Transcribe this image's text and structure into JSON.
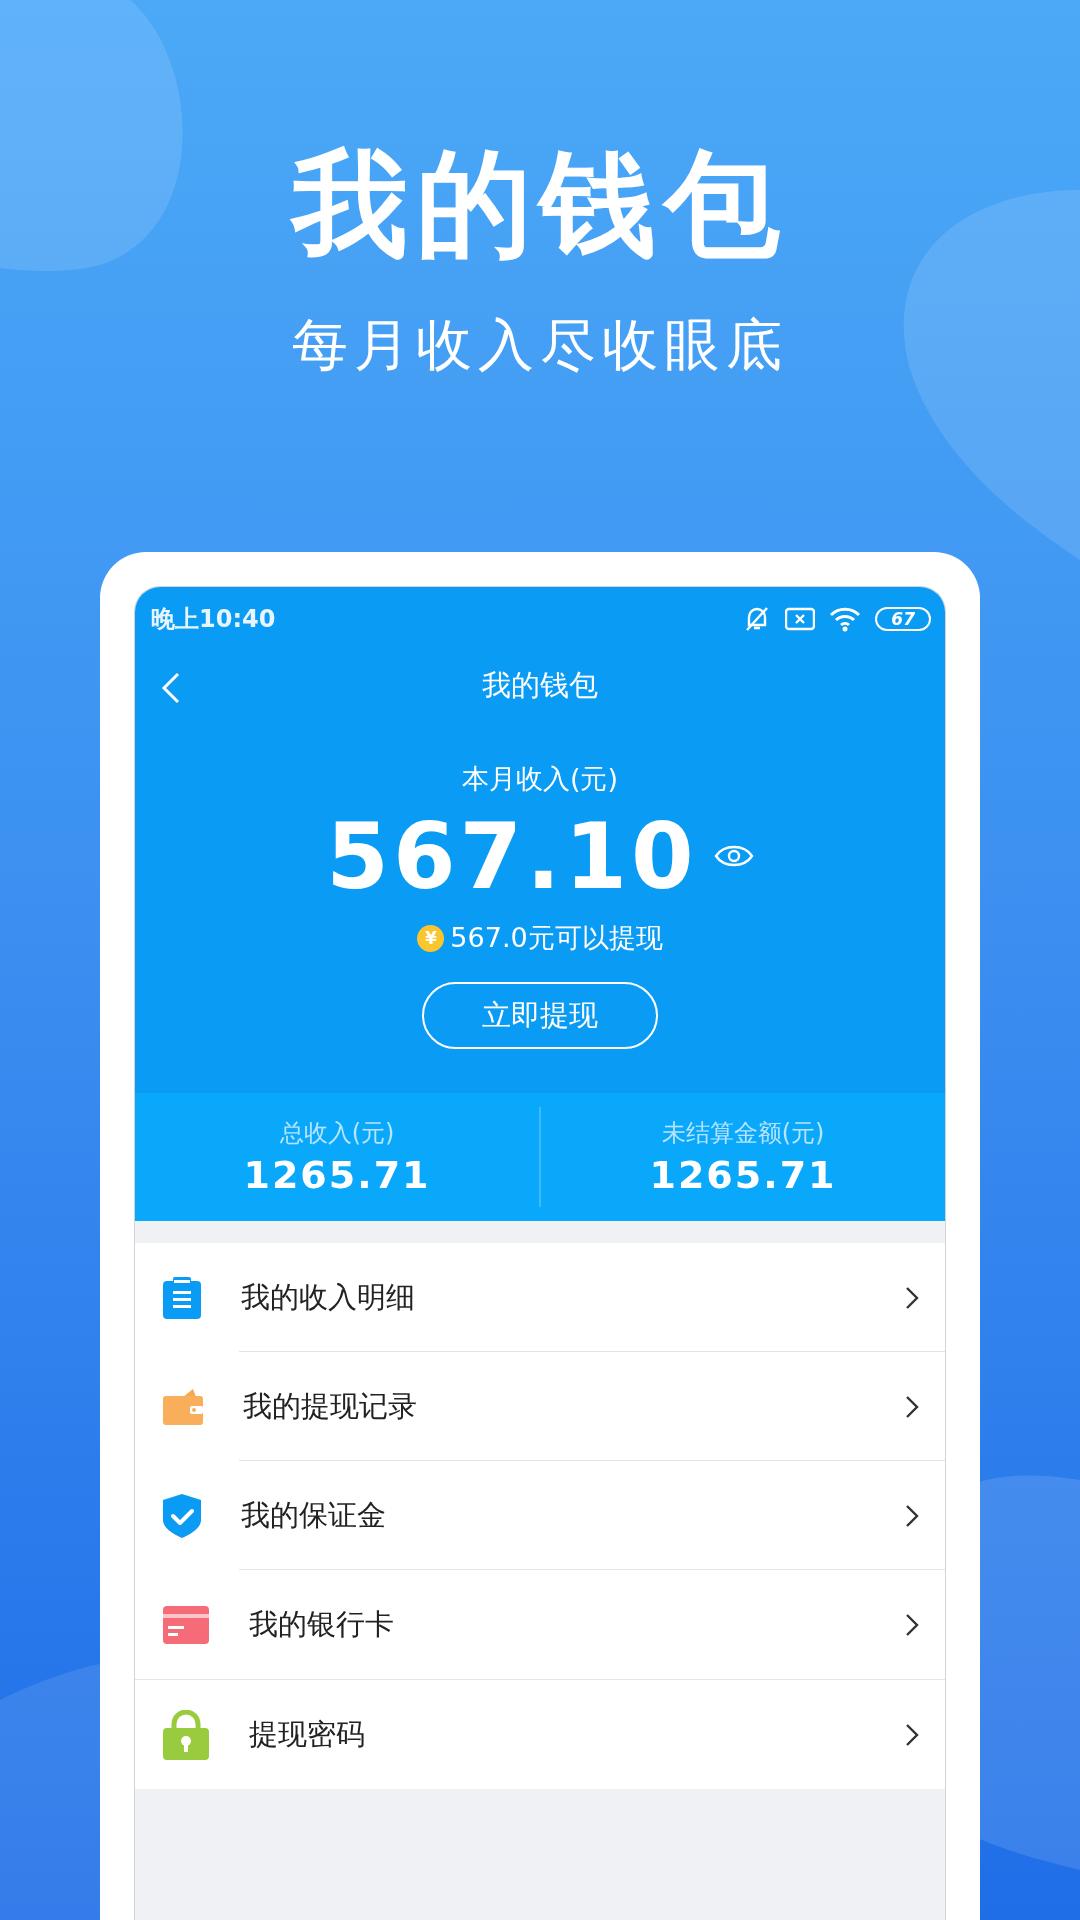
{
  "headline": "我的钱包",
  "tagline": "每月收入尽收眼底",
  "phone": {
    "status_bar": {
      "time": "晚上10:40",
      "battery": "67"
    },
    "nav": {
      "title": "我的钱包"
    },
    "balance": {
      "label": "本月收入(元)",
      "amount": "567.10",
      "coin": "¥",
      "withdrawable": "567.0元可以提现",
      "button": "立即提现"
    },
    "stats": [
      {
        "label": "总收入(元)",
        "value": "1265.71"
      },
      {
        "label": "未结算金额(元)",
        "value": "1265.71"
      }
    ],
    "menu": [
      {
        "label": "我的收入明细",
        "kind": "clipboard"
      },
      {
        "label": "我的提现记录",
        "kind": "wallet"
      },
      {
        "label": "我的保证金",
        "kind": "shield"
      },
      {
        "label": "我的银行卡",
        "kind": "card"
      },
      {
        "label": "提现密码",
        "kind": "lock"
      }
    ]
  }
}
